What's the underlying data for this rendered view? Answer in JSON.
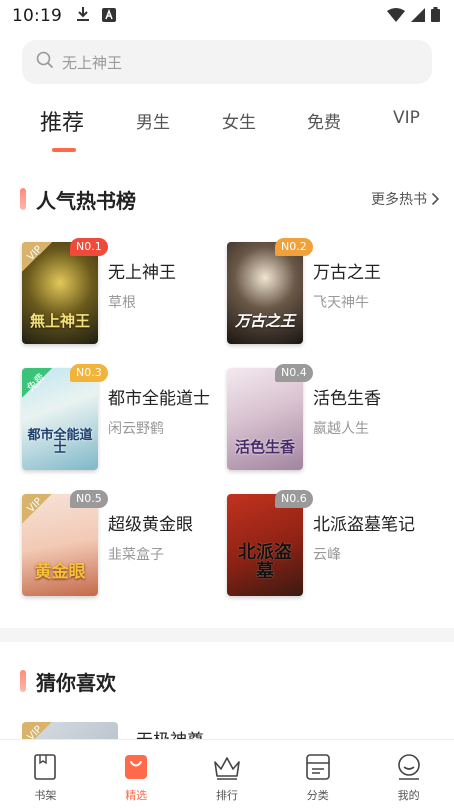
{
  "status_bar": {
    "time": "10:19",
    "left_icons": [
      "download-icon",
      "notification-a-icon"
    ],
    "right_icons": [
      "wifi-icon",
      "cellular-icon",
      "battery-icon"
    ]
  },
  "search": {
    "placeholder": "无上神王",
    "icon": "search-icon"
  },
  "tabs": [
    {
      "label": "推荐",
      "active": true
    },
    {
      "label": "男生",
      "active": false
    },
    {
      "label": "女生",
      "active": false
    },
    {
      "label": "免费",
      "active": false
    },
    {
      "label": "VIP",
      "active": false
    }
  ],
  "ranking": {
    "title": "人气热书榜",
    "more_label": "更多热书",
    "books": [
      {
        "rank": "N0.1",
        "title": "无上神王",
        "author": "草根",
        "corner": "VIP",
        "cover_text": "無上神王",
        "badge_color": "#f04a3a"
      },
      {
        "rank": "N0.2",
        "title": "万古之王",
        "author": "飞天神牛",
        "corner": "",
        "cover_text": "万古之王",
        "badge_color": "#f2a13a"
      },
      {
        "rank": "N0.3",
        "title": "都市全能道士",
        "author": "闲云野鹤",
        "corner": "免费",
        "cover_text": "都市全能道士",
        "badge_color": "#f2b33a"
      },
      {
        "rank": "N0.4",
        "title": "活色生香",
        "author": "嬴越人生",
        "corner": "",
        "cover_text": "活色生香",
        "badge_color": "#9a9a9a"
      },
      {
        "rank": "N0.5",
        "title": "超级黄金眼",
        "author": "韭菜盒子",
        "corner": "VIP",
        "cover_text": "黄金眼",
        "badge_color": "#9a9a9a"
      },
      {
        "rank": "N0.6",
        "title": "北派盗墓笔记",
        "author": "云峰",
        "corner": "",
        "cover_text": "北派盗墓",
        "badge_color": "#9a9a9a"
      }
    ]
  },
  "guess": {
    "title": "猜你喜欢",
    "first_book_title": "无极神尊",
    "first_corner": "VIP"
  },
  "bottom_nav": [
    {
      "label": "书架",
      "icon": "bookshelf-icon",
      "active": false
    },
    {
      "label": "精选",
      "icon": "featured-bag-icon",
      "active": true
    },
    {
      "label": "排行",
      "icon": "crown-icon",
      "active": false
    },
    {
      "label": "分类",
      "icon": "category-icon",
      "active": false
    },
    {
      "label": "我的",
      "icon": "profile-icon",
      "active": false
    }
  ],
  "colors": {
    "accent": "#ff6b4a",
    "search_bg": "#f3f3f3",
    "muted_text": "#999999"
  }
}
